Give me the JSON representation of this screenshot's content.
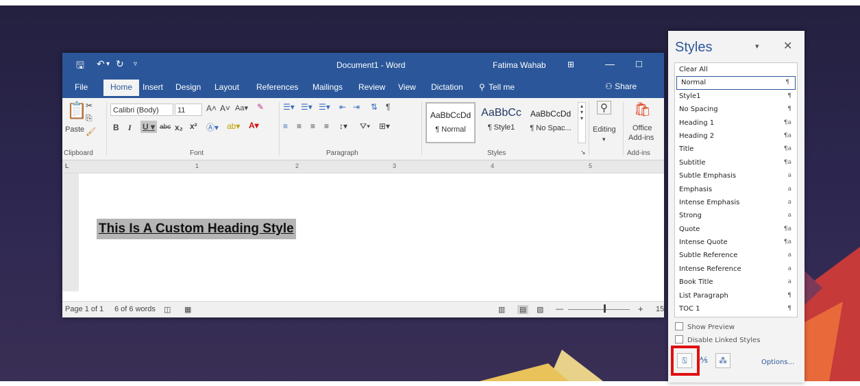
{
  "window": {
    "title": "Document1  -  Word",
    "user": "Fatima Wahab"
  },
  "tabs": [
    "File",
    "Home",
    "Insert",
    "Design",
    "Layout",
    "References",
    "Mailings",
    "Review",
    "View",
    "Dictation"
  ],
  "tell_me": "Tell me",
  "share": "Share",
  "ribbon": {
    "paste": "Paste",
    "font_name": "Calibri (Body)",
    "font_size": "11",
    "groups": {
      "clipboard": "Clipboard",
      "font": "Font",
      "paragraph": "Paragraph",
      "styles": "Styles",
      "addins": "Add-ins"
    },
    "style_gallery": [
      {
        "sample": "AaBbCcDd",
        "name": "¶ Normal"
      },
      {
        "sample": "AaBbCc",
        "name": "¶ Style1"
      },
      {
        "sample": "AaBbCcDd",
        "name": "¶ No Spac..."
      }
    ],
    "editing": "Editing",
    "office_addins_line1": "Office",
    "office_addins_line2": "Add-ins"
  },
  "ruler_numbers": [
    "1",
    "2",
    "3",
    "4",
    "5"
  ],
  "document": {
    "heading": "This Is A Custom Heading Style"
  },
  "status": {
    "page": "Page 1 of 1",
    "words": "6 of 6 words",
    "zoom_partial": "15"
  },
  "styles_pane": {
    "title": "Styles",
    "items": [
      {
        "name": "Clear All",
        "mark": ""
      },
      {
        "name": "Normal",
        "mark": "¶"
      },
      {
        "name": "Style1",
        "mark": "¶"
      },
      {
        "name": "No Spacing",
        "mark": "¶"
      },
      {
        "name": "Heading 1",
        "mark": "¶a"
      },
      {
        "name": "Heading 2",
        "mark": "¶a"
      },
      {
        "name": "Title",
        "mark": "¶a"
      },
      {
        "name": "Subtitle",
        "mark": "¶a"
      },
      {
        "name": "Subtle Emphasis",
        "mark": "a"
      },
      {
        "name": "Emphasis",
        "mark": "a"
      },
      {
        "name": "Intense Emphasis",
        "mark": "a"
      },
      {
        "name": "Strong",
        "mark": "a"
      },
      {
        "name": "Quote",
        "mark": "¶a"
      },
      {
        "name": "Intense Quote",
        "mark": "¶a"
      },
      {
        "name": "Subtle Reference",
        "mark": "a"
      },
      {
        "name": "Intense Reference",
        "mark": "a"
      },
      {
        "name": "Book Title",
        "mark": "a"
      },
      {
        "name": "List Paragraph",
        "mark": "¶"
      },
      {
        "name": "TOC 1",
        "mark": "¶"
      }
    ],
    "selected_index": 1,
    "show_preview": "Show Preview",
    "disable_linked": "Disable Linked Styles",
    "options": "Options..."
  },
  "colors": {
    "word_blue": "#2b579a",
    "highlight_red": "#e01010"
  }
}
